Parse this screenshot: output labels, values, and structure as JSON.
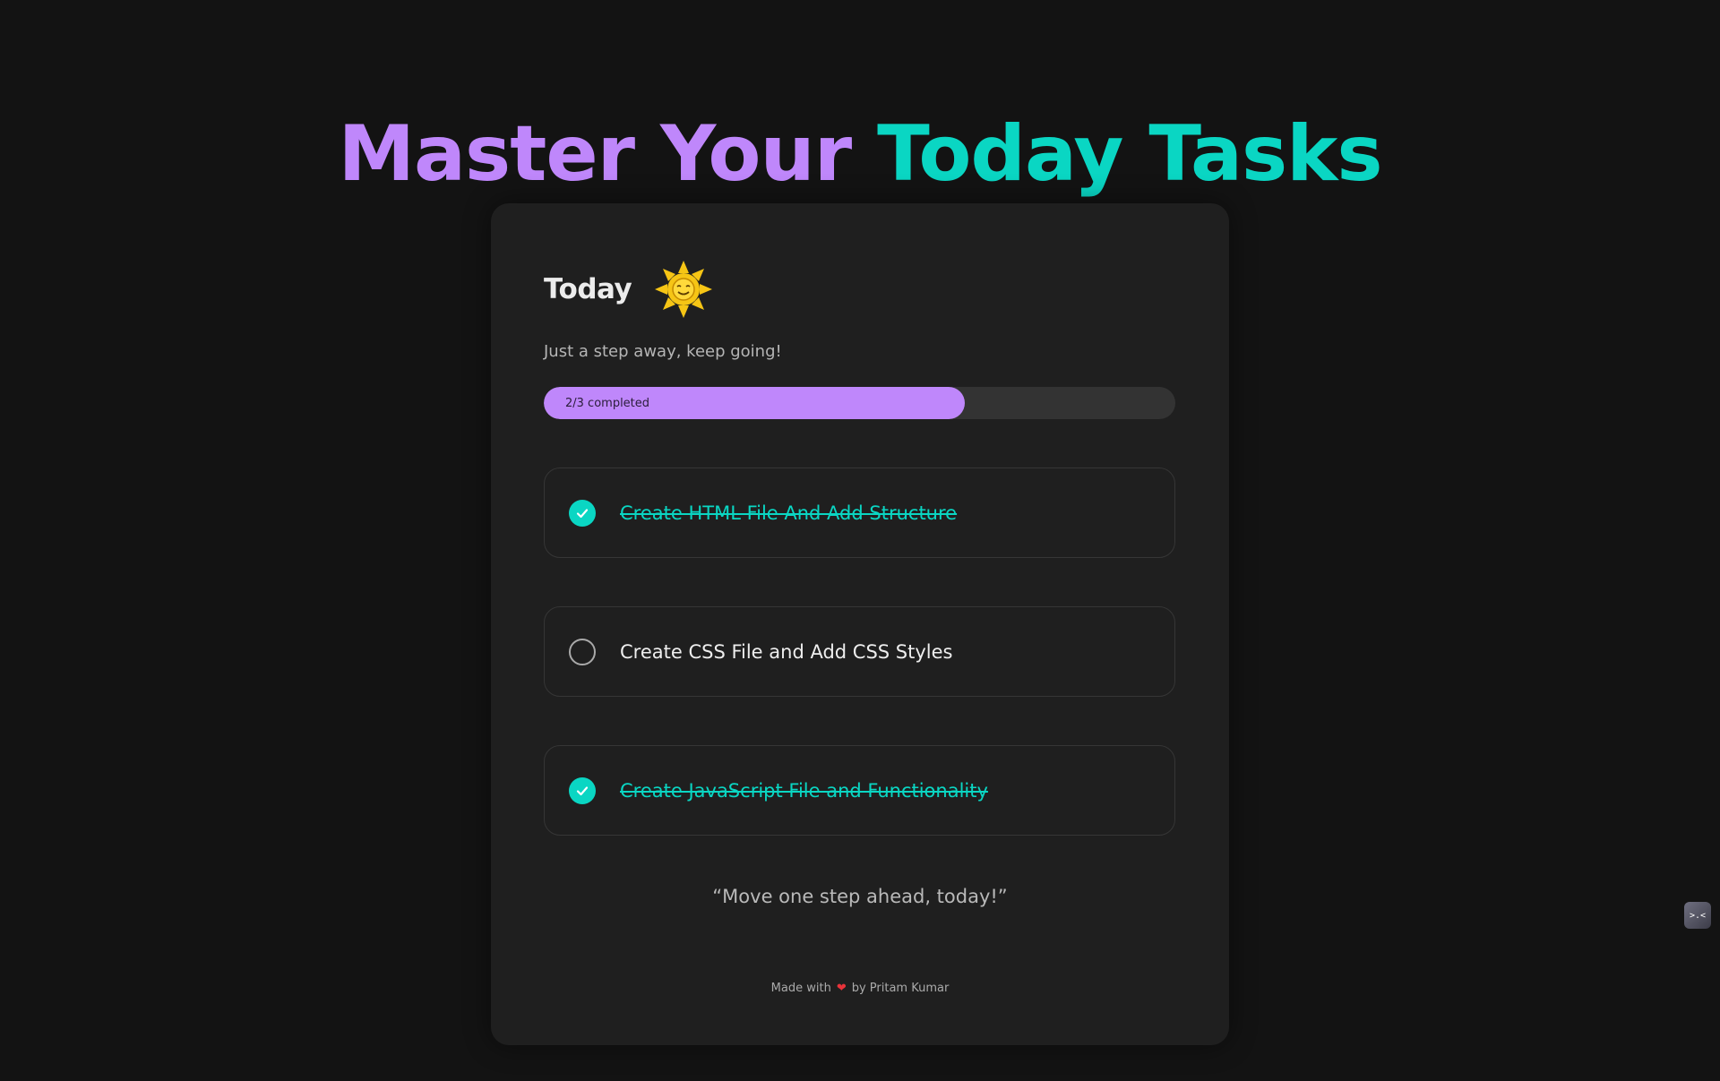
{
  "header": {
    "title_part1": "Master Your",
    "title_part2": "Today Tasks",
    "color_purple": "#bf87fb",
    "color_teal": "#0ad6c3"
  },
  "card": {
    "title": "Today",
    "title_icon": "sun-emoji-icon",
    "subtitle": "Just a step away, keep going!",
    "progress": {
      "completed": 2,
      "total": 3,
      "label": "2/3 completed"
    },
    "tasks": [
      {
        "label": "Create HTML File And Add Structure",
        "completed": true
      },
      {
        "label": "Create CSS File and Add CSS Styles",
        "completed": false
      },
      {
        "label": "Create JavaScript File and Functionality",
        "completed": true
      }
    ],
    "quote": "“Move one step ahead, today!”",
    "footer": {
      "prefix": "Made with",
      "heart_icon": "heart-icon",
      "heart_glyph": "❤",
      "suffix": "by Pritam Kumar"
    }
  },
  "widget": {
    "icon": "sleepy-face-widget-icon",
    "glyph": ">.<"
  }
}
